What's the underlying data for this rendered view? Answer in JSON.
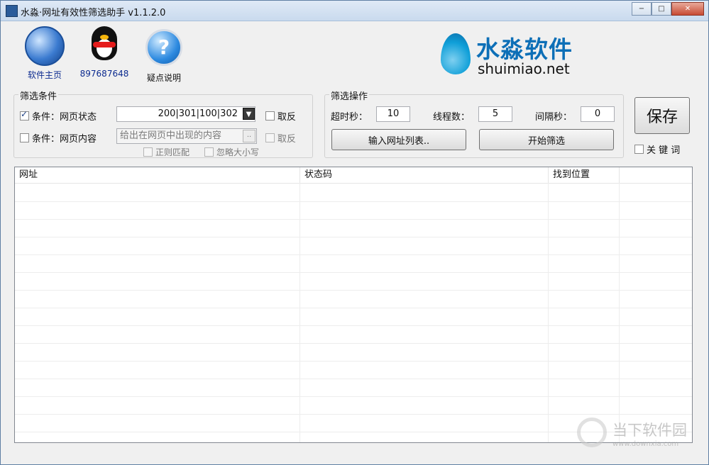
{
  "window": {
    "title": "水淼·网址有效性筛选助手 v1.1.2.0",
    "btn_minimize": "−",
    "btn_maximize": "□",
    "btn_close": "✕"
  },
  "toolbar": {
    "items": [
      {
        "label": "软件主页",
        "icon": "globe-icon"
      },
      {
        "label": "897687648",
        "icon": "qq-penguin-icon"
      },
      {
        "label": "疑点说明",
        "icon": "help-icon"
      }
    ]
  },
  "logo": {
    "cn": "水淼软件",
    "en": "shuimiao.net"
  },
  "filter": {
    "title": "筛选条件",
    "cond1_label": "条件：网页状态",
    "cond1_value": "200|301|100|302",
    "cond1_dropdown": "▼",
    "cond1_invert": "取反",
    "cond2_label": "条件：网页内容",
    "cond2_placeholder": "给出在网页中出现的内容",
    "cond2_more": "..",
    "cond2_invert": "取反",
    "regex": "正则匹配",
    "ignore_case": "忽略大小写"
  },
  "operation": {
    "title": "筛选操作",
    "timeout_label": "超时秒：",
    "timeout_value": "10",
    "threads_label": "线程数：",
    "threads_value": "5",
    "interval_label": "间隔秒：",
    "interval_value": "0",
    "input_btn": "输入网址列表..",
    "start_btn": "开始筛选"
  },
  "save": {
    "label": "保存",
    "keyword": "关 键 词"
  },
  "table": {
    "columns": [
      "网址",
      "状态码",
      "找到位置"
    ]
  },
  "watermark": {
    "cn": "当下软件园",
    "url": "www.downxia.com"
  }
}
